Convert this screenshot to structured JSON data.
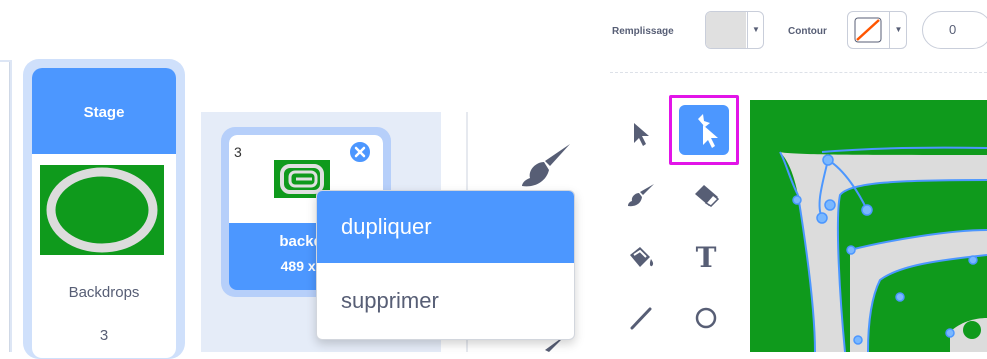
{
  "stage": {
    "header": "Stage",
    "backdrops_label": "Backdrops",
    "backdrops_count": "3"
  },
  "costume": {
    "number": "3",
    "name": "backdr",
    "size": "489 x 3"
  },
  "context_menu": {
    "items": [
      {
        "label": "dupliquer",
        "selected": true
      },
      {
        "label": "supprimer",
        "selected": false
      }
    ]
  },
  "paint_toolbar": {
    "fill_label": "Remplissage",
    "fill_color": "#e0e0e0",
    "outline_label": "Contour",
    "outline_color": "none",
    "outline_width": "0"
  },
  "tools": [
    {
      "name": "select",
      "icon": "arrow-pointer-icon"
    },
    {
      "name": "reshape",
      "icon": "reshape-icon",
      "active": true
    },
    {
      "name": "brush",
      "icon": "brush-icon"
    },
    {
      "name": "eraser",
      "icon": "eraser-icon"
    },
    {
      "name": "fill",
      "icon": "paint-bucket-icon"
    },
    {
      "name": "text",
      "icon": "text-icon",
      "label": "T"
    },
    {
      "name": "line",
      "icon": "line-icon"
    },
    {
      "name": "circle",
      "icon": "circle-icon"
    }
  ],
  "colors": {
    "accent": "#4c97ff",
    "highlight": "#e214e8",
    "canvas_green": "#0f9a1c"
  }
}
